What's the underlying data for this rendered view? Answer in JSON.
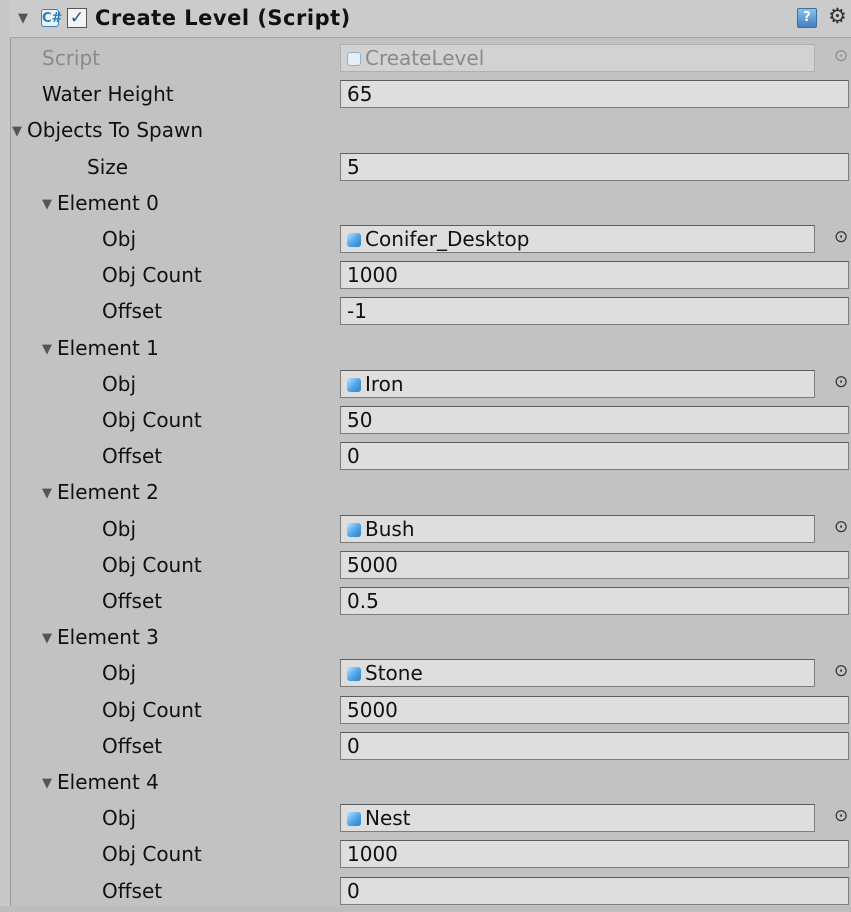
{
  "header": {
    "title": "Create Level (Script)",
    "foldout": "▼",
    "enabled_check": "✓",
    "script_icon_glyph": "C#",
    "help_icon_glyph": "?",
    "gear_icon_glyph": "⚙"
  },
  "script_row": {
    "label": "Script",
    "value": "CreateLevel"
  },
  "water_height": {
    "label": "Water Height",
    "value": "65"
  },
  "objects_to_spawn": {
    "label": "Objects To Spawn",
    "size_label": "Size",
    "size_value": "5",
    "elements": [
      {
        "label": "Element 0",
        "obj_label": "Obj",
        "obj_value": "Conifer_Desktop",
        "count_label": "Obj Count",
        "count_value": "1000",
        "offset_label": "Offset",
        "offset_value": "-1"
      },
      {
        "label": "Element 1",
        "obj_label": "Obj",
        "obj_value": "Iron",
        "count_label": "Obj Count",
        "count_value": "50",
        "offset_label": "Offset",
        "offset_value": "0"
      },
      {
        "label": "Element 2",
        "obj_label": "Obj",
        "obj_value": "Bush",
        "count_label": "Obj Count",
        "count_value": "5000",
        "offset_label": "Offset",
        "offset_value": "0.5"
      },
      {
        "label": "Element 3",
        "obj_label": "Obj",
        "obj_value": "Stone",
        "count_label": "Obj Count",
        "count_value": "5000",
        "offset_label": "Offset",
        "offset_value": "0"
      },
      {
        "label": "Element 4",
        "obj_label": "Obj",
        "obj_value": "Nest",
        "count_label": "Obj Count",
        "count_value": "1000",
        "offset_label": "Offset",
        "offset_value": "0"
      }
    ]
  },
  "glyphs": {
    "foldout_open": "▼",
    "object_picker": "⊙"
  },
  "colors": {
    "panel_bg": "#c2c2c2",
    "field_bg": "#dedede",
    "accent": "#2f7bb5"
  }
}
